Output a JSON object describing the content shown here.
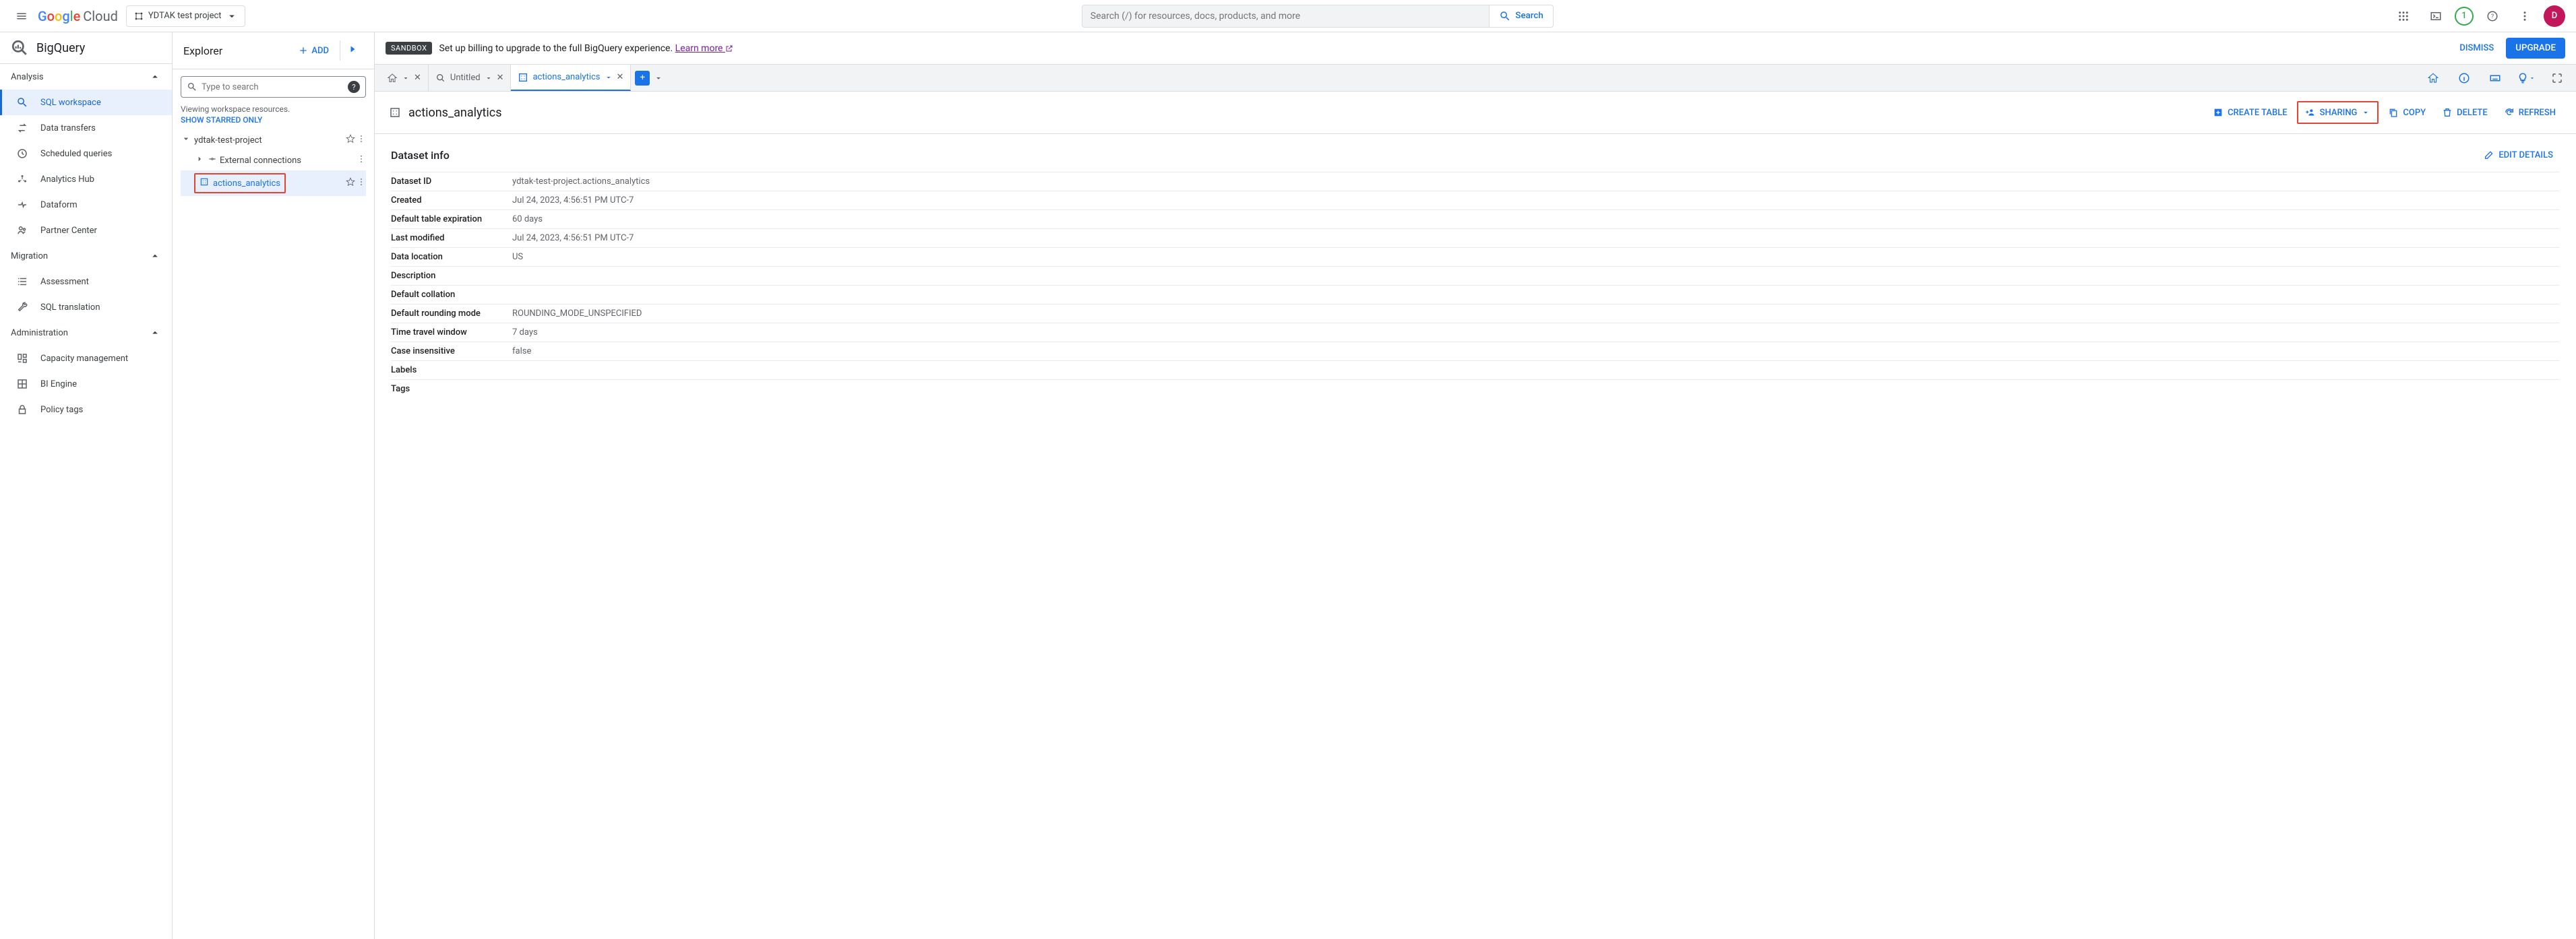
{
  "header": {
    "logo_text": "Cloud",
    "project": "YDTAK test project",
    "search_placeholder": "Search (/) for resources, docs, products, and more",
    "search_btn": "Search",
    "badge_count": "1",
    "avatar_initial": "D"
  },
  "leftnav": {
    "product": "BigQuery",
    "sections": {
      "analysis": "Analysis",
      "migration": "Migration",
      "administration": "Administration"
    },
    "items": {
      "sql": "SQL workspace",
      "transfers": "Data transfers",
      "scheduled": "Scheduled queries",
      "hub": "Analytics Hub",
      "dataform": "Dataform",
      "partner": "Partner Center",
      "assessment": "Assessment",
      "translation": "SQL translation",
      "capacity": "Capacity management",
      "biengine": "BI Engine",
      "policy": "Policy tags"
    }
  },
  "explorer": {
    "title": "Explorer",
    "add": "ADD",
    "search_placeholder": "Type to search",
    "viewing_msg": "Viewing workspace resources.",
    "starred_link": "SHOW STARRED ONLY",
    "project": "ydtak-test-project",
    "external": "External connections",
    "dataset": "actions_analytics"
  },
  "banner": {
    "chip": "SANDBOX",
    "text": "Set up billing to upgrade to the full BigQuery experience. ",
    "learn_more": "Learn more",
    "dismiss": "DISMISS",
    "upgrade": "UPGRADE"
  },
  "tabs": {
    "untitled": "Untitled",
    "dataset": "actions_analytics"
  },
  "content": {
    "title": "actions_analytics",
    "actions": {
      "create_table": "CREATE TABLE",
      "sharing": "SHARING",
      "copy": "COPY",
      "delete": "DELETE",
      "refresh": "REFRESH"
    },
    "info_heading": "Dataset info",
    "edit_details": "EDIT DETAILS",
    "rows": {
      "id_k": "Dataset ID",
      "id_v": "ydtak-test-project.actions_analytics",
      "created_k": "Created",
      "created_v": "Jul 24, 2023, 4:56:51 PM UTC-7",
      "exp_k": "Default table expiration",
      "exp_v": "60 days",
      "mod_k": "Last modified",
      "mod_v": "Jul 24, 2023, 4:56:51 PM UTC-7",
      "loc_k": "Data location",
      "loc_v": "US",
      "desc_k": "Description",
      "desc_v": "",
      "coll_k": "Default collation",
      "coll_v": "",
      "round_k": "Default rounding mode",
      "round_v": "ROUNDING_MODE_UNSPECIFIED",
      "travel_k": "Time travel window",
      "travel_v": "7 days",
      "case_k": "Case insensitive",
      "case_v": "false",
      "labels_k": "Labels",
      "labels_v": "",
      "tags_k": "Tags",
      "tags_v": ""
    }
  }
}
